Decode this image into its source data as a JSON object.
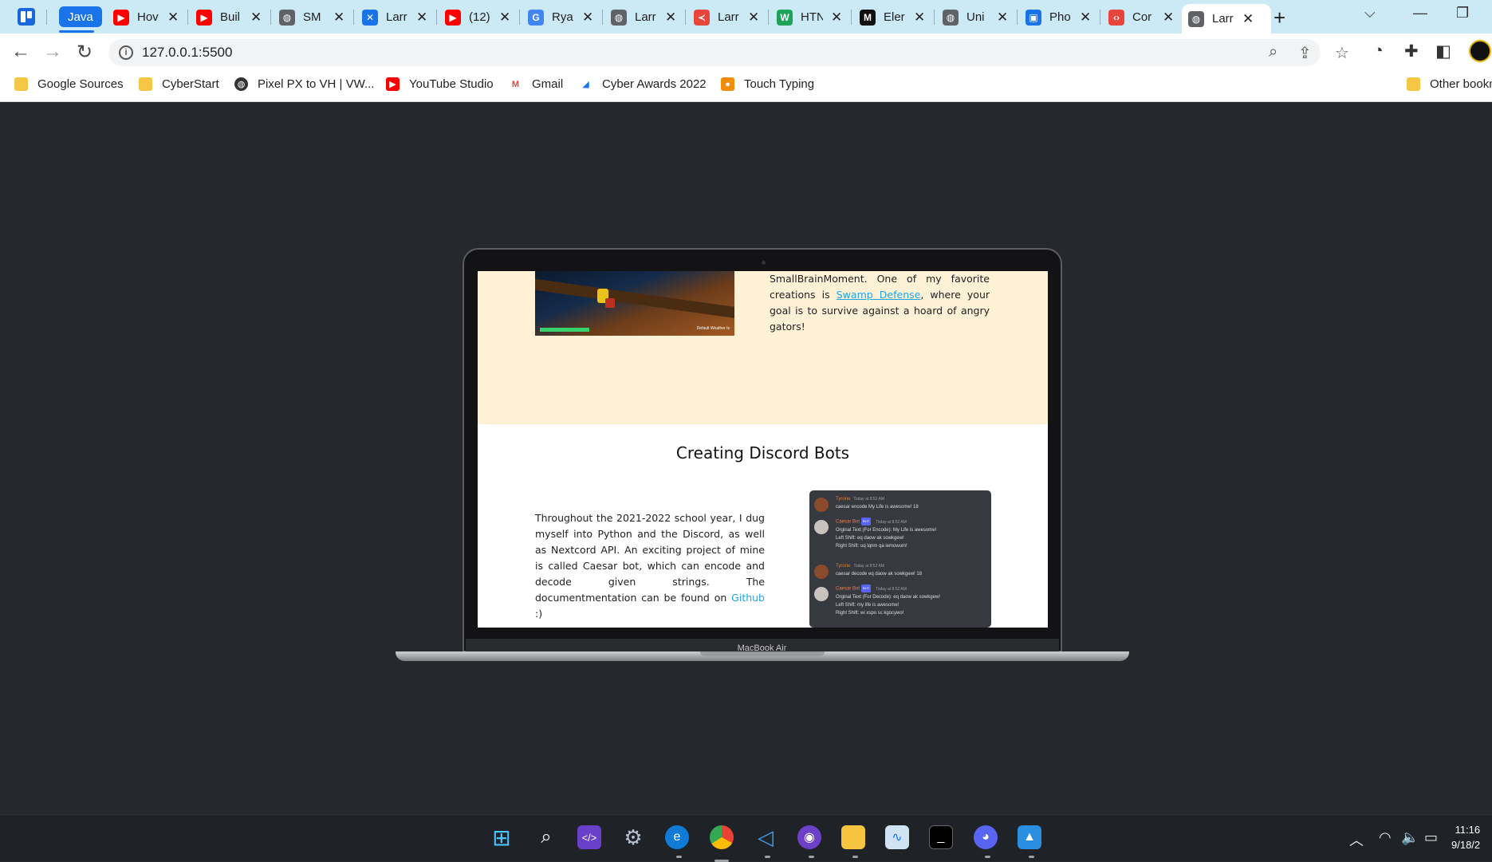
{
  "browser": {
    "pinned_tab_label": "Java",
    "tabs": [
      {
        "title": "Hov",
        "icon": "youtube-icon",
        "color": "#ff0000"
      },
      {
        "title": "Buil",
        "icon": "youtube-icon",
        "color": "#ff0000"
      },
      {
        "title": "SM",
        "icon": "globe-icon",
        "color": "#5f6368"
      },
      {
        "title": "Larr",
        "icon": "tool-icon",
        "color": "#1a73e8"
      },
      {
        "title": "(12)",
        "icon": "youtube-icon",
        "color": "#ff0000"
      },
      {
        "title": "Rya",
        "icon": "google-icon",
        "color": "#4285f4"
      },
      {
        "title": "Larr",
        "icon": "globe-icon",
        "color": "#5f6368"
      },
      {
        "title": "Larr",
        "icon": "logo-icon",
        "color": "#e8453c"
      },
      {
        "title": "HTN",
        "icon": "w-icon",
        "color": "#1ea35b"
      },
      {
        "title": "Eler",
        "icon": "m-icon",
        "color": "#111111"
      },
      {
        "title": "Uni",
        "icon": "globe-icon",
        "color": "#5f6368"
      },
      {
        "title": "Pho",
        "icon": "photo-icon",
        "color": "#1a73e8"
      },
      {
        "title": "Cor",
        "icon": "code-icon",
        "color": "#e8453c"
      },
      {
        "title": "Larr",
        "icon": "globe-icon",
        "color": "#5f6368",
        "active": true
      }
    ],
    "address": "127.0.0.1:5500"
  },
  "bookmarks": [
    {
      "label": "Google Sources",
      "icon": "folder-icon"
    },
    {
      "label": "CyberStart",
      "icon": "folder-icon"
    },
    {
      "label": "Pixel PX to VH | VW...",
      "icon": "globe-icon"
    },
    {
      "label": "YouTube Studio",
      "icon": "youtube-icon"
    },
    {
      "label": "Gmail",
      "icon": "gmail-icon"
    },
    {
      "label": "Cyber Awards 2022",
      "icon": "award-icon"
    },
    {
      "label": "Touch Typing",
      "icon": "keyboard-icon"
    }
  ],
  "other_bookmarks": "Other bookma",
  "page": {
    "game_hud_label": "Default Weather Is",
    "intro_text_pre": "SmallBrainMoment. One of my favorite creations is ",
    "intro_link": "Swamp Defense",
    "intro_text_post": ", where your goal is to survive against a hoard of angry gators!",
    "section_title": "Creating Discord Bots",
    "body_pre": "Throughout the 2021-2022 school year, I dug myself into Python and the Discord, as well as Nextcord API. An exciting project of mine is called Caesar bot, which can encode and decode given strings. The documentmentation can be found on ",
    "body_link": "Github",
    "body_post": " :)"
  },
  "discord": {
    "messages": [
      {
        "author": "Tyrone",
        "time": "Today at 8:52 AM",
        "lines": [
          "caesar encode My Life is awesome! 18"
        ]
      },
      {
        "author": "Caesar Bot",
        "bot": "BOT",
        "time": "Today at 8:52 AM",
        "lines": [
          "Orginal Text (For Encode): My Life is awesome!",
          "Left Shift: eq daow ak sowkgew!",
          "Right Shift: uq lqnm qa iemowum!"
        ]
      },
      {
        "author": "Tyrone",
        "time": "Today at 8:52 AM",
        "lines": [
          "caesar decode eq daow ak sowkgew! 18"
        ]
      },
      {
        "author": "Caesar Bot",
        "bot": "BOT",
        "time": "Today at 8:52 AM",
        "lines": [
          "Orginal Text (For Decode): eq daow ak sowkgew!",
          "Left Shift: my life is awesome!",
          "Right Shift: wi xspo sc kgocywo!"
        ]
      }
    ]
  },
  "laptop_label": "MacBook Air",
  "taskbar": {
    "clock_time": "11:16",
    "clock_date": "9/18/2"
  }
}
